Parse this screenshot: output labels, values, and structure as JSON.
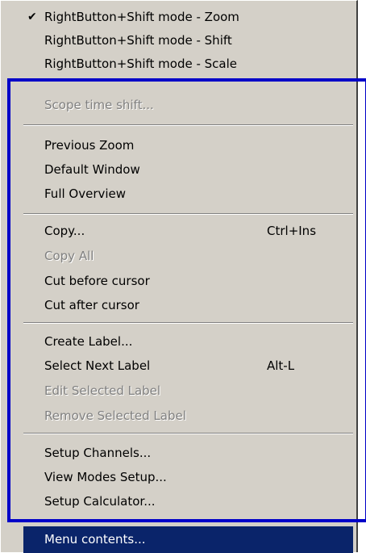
{
  "menu": {
    "mode_items": [
      {
        "label": "RightButton+Shift mode - Zoom",
        "checked": true,
        "check_glyph": "✔"
      },
      {
        "label": "RightButton+Shift mode - Shift",
        "checked": false
      },
      {
        "label": "RightButton+Shift mode - Scale",
        "checked": false
      }
    ],
    "scope_time_shift": "Scope time shift...",
    "previous_zoom": "Previous Zoom",
    "default_window": "Default Window",
    "full_overview": "Full Overview",
    "copy": {
      "label": "Copy...",
      "shortcut": "Ctrl+Ins"
    },
    "copy_all": "Copy All",
    "cut_before_cursor": "Cut before cursor",
    "cut_after_cursor": "Cut after cursor",
    "create_label": "Create Label...",
    "select_next_label": {
      "label": "Select Next Label",
      "shortcut": "Alt-L"
    },
    "edit_selected_label": "Edit Selected Label",
    "remove_selected_label": "Remove Selected Label",
    "setup_channels": "Setup Channels...",
    "view_modes_setup": "View Modes Setup...",
    "setup_calculator": "Setup Calculator...",
    "menu_contents": "Menu contents..."
  },
  "colors": {
    "menu_background": "#d4d0c8",
    "highlight_background": "#0a246a",
    "highlight_text": "#ffffff",
    "disabled_text": "#808080",
    "annotation_frame": "#0000c8"
  }
}
